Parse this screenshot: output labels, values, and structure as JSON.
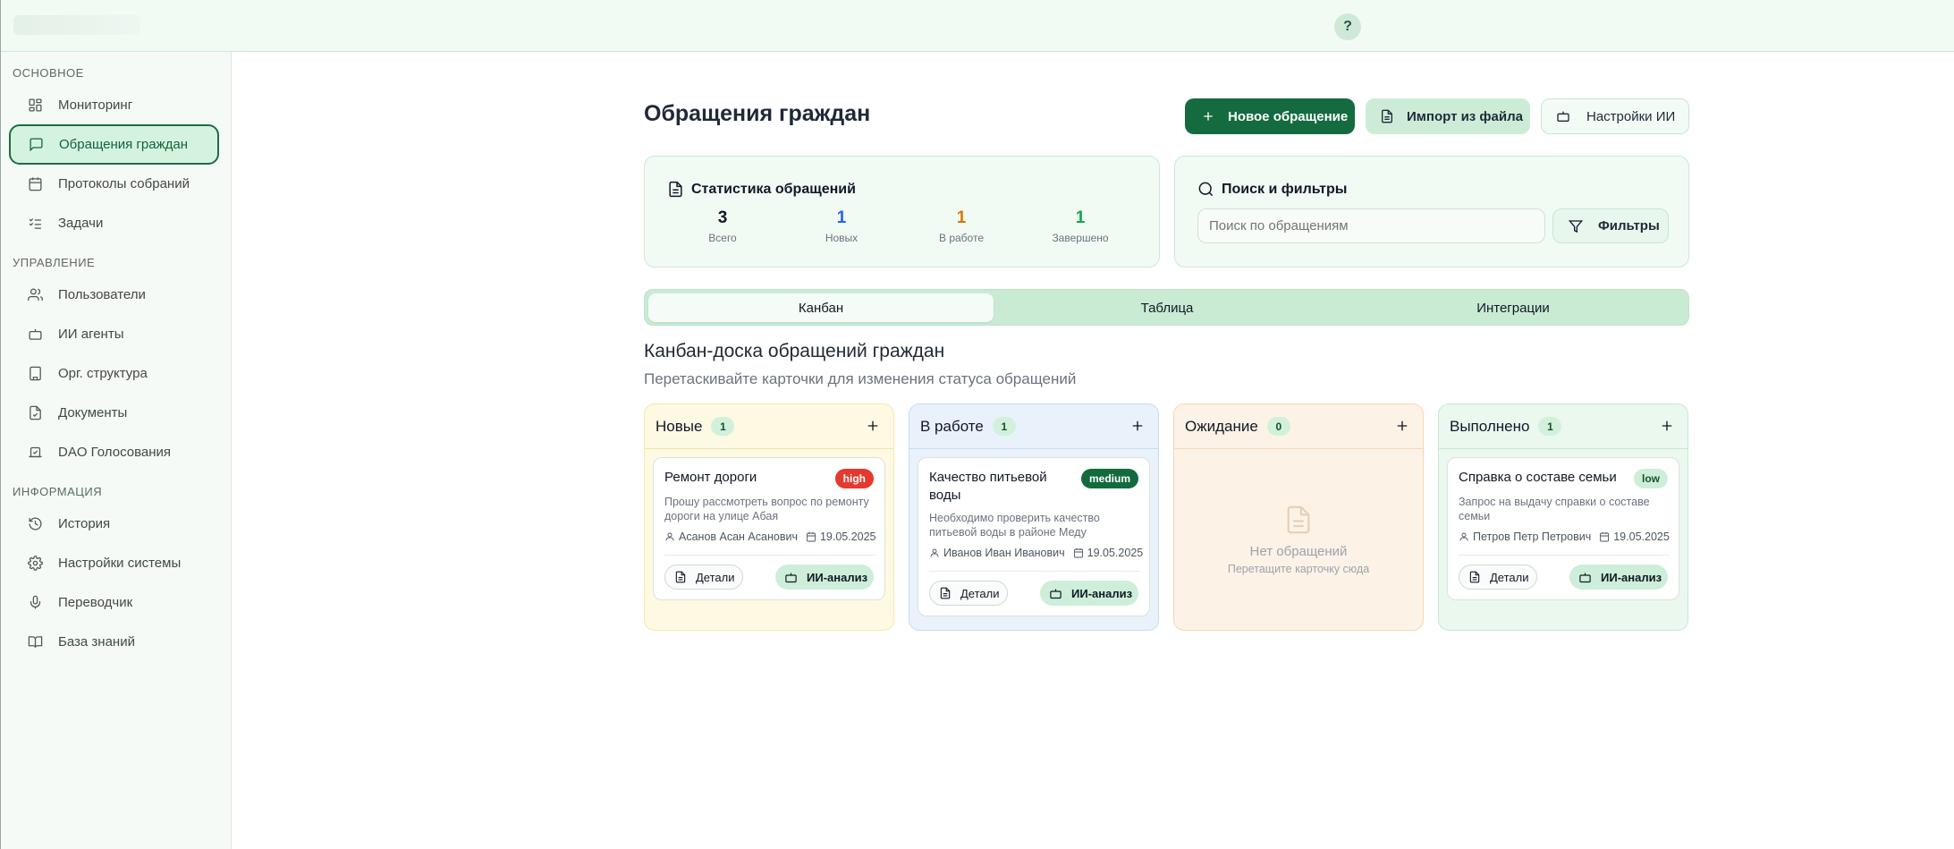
{
  "topbar": {
    "help_label": "?"
  },
  "sidebar": {
    "sections": [
      {
        "title": "ОСНОВНОЕ"
      },
      {
        "title": "УПРАВЛЕНИЕ"
      },
      {
        "title": "ИНФОРМАЦИЯ"
      }
    ],
    "items": [
      {
        "label": "Мониторинг",
        "icon": "dashboard-icon"
      },
      {
        "label": "Обращения граждан",
        "icon": "message-icon",
        "active": true
      },
      {
        "label": "Протоколы собраний",
        "icon": "calendar-icon"
      },
      {
        "label": "Задачи",
        "icon": "checklist-icon"
      },
      {
        "label": "Пользователи",
        "icon": "users-icon"
      },
      {
        "label": "ИИ агенты",
        "icon": "bot-icon"
      },
      {
        "label": "Орг. структура",
        "icon": "building-icon"
      },
      {
        "label": "Документы",
        "icon": "document-icon"
      },
      {
        "label": "DAO Голосования",
        "icon": "vote-icon"
      },
      {
        "label": "История",
        "icon": "history-icon"
      },
      {
        "label": "Настройки системы",
        "icon": "gear-icon"
      },
      {
        "label": "Переводчик",
        "icon": "mic-icon"
      },
      {
        "label": "База знаний",
        "icon": "book-icon"
      }
    ]
  },
  "header": {
    "title": "Обращения граждан",
    "new_button": "Новое обращение",
    "import_button": "Импорт из файла",
    "ai_settings_button": "Настройки ИИ"
  },
  "stats": {
    "title": "Статистика обращений",
    "items": [
      {
        "value": "3",
        "label": "Всего",
        "color": "#111827"
      },
      {
        "value": "1",
        "label": "Новых",
        "color": "#2563eb"
      },
      {
        "value": "1",
        "label": "В работе",
        "color": "#d97706"
      },
      {
        "value": "1",
        "label": "Завершено",
        "color": "#16a34a"
      }
    ]
  },
  "search": {
    "title": "Поиск и фильтры",
    "placeholder": "Поиск по обращениям",
    "filters_button": "Фильтры"
  },
  "tabs": [
    {
      "label": "Канбан",
      "active": true
    },
    {
      "label": "Таблица"
    },
    {
      "label": "Интеграции"
    }
  ],
  "board": {
    "title": "Канбан-доска обращений граждан",
    "subtitle": "Перетаскивайте карточки для изменения статуса обращений",
    "columns": [
      {
        "name": "Новые",
        "count": "1",
        "card": {
          "title": "Ремонт дороги",
          "priority": "high",
          "description": "Прошу рассмотреть вопрос по ремонту дороги на улице Абая",
          "author": "Асанов Асан Асанович",
          "date": "19.05.2025",
          "details": "Детали",
          "ai": "ИИ-анализ"
        }
      },
      {
        "name": "В работе",
        "count": "1",
        "card": {
          "title": "Качество питьевой воды",
          "priority": "medium",
          "description": "Необходимо проверить качество питьевой воды в районе Меду",
          "author": "Иванов Иван Иванович",
          "date": "19.05.2025",
          "details": "Детали",
          "ai": "ИИ-анализ"
        }
      },
      {
        "name": "Ожидание",
        "count": "0",
        "empty": {
          "title": "Нет обращений",
          "hint": "Перетащите карточку сюда"
        }
      },
      {
        "name": "Выполнено",
        "count": "1",
        "card": {
          "title": "Справка о составе семьи",
          "priority": "low",
          "description": "Запрос на выдачу справки о составе семьи",
          "author": "Петров Петр Петрович",
          "date": "19.05.2025",
          "details": "Детали",
          "ai": "ИИ-анализ"
        }
      }
    ]
  }
}
